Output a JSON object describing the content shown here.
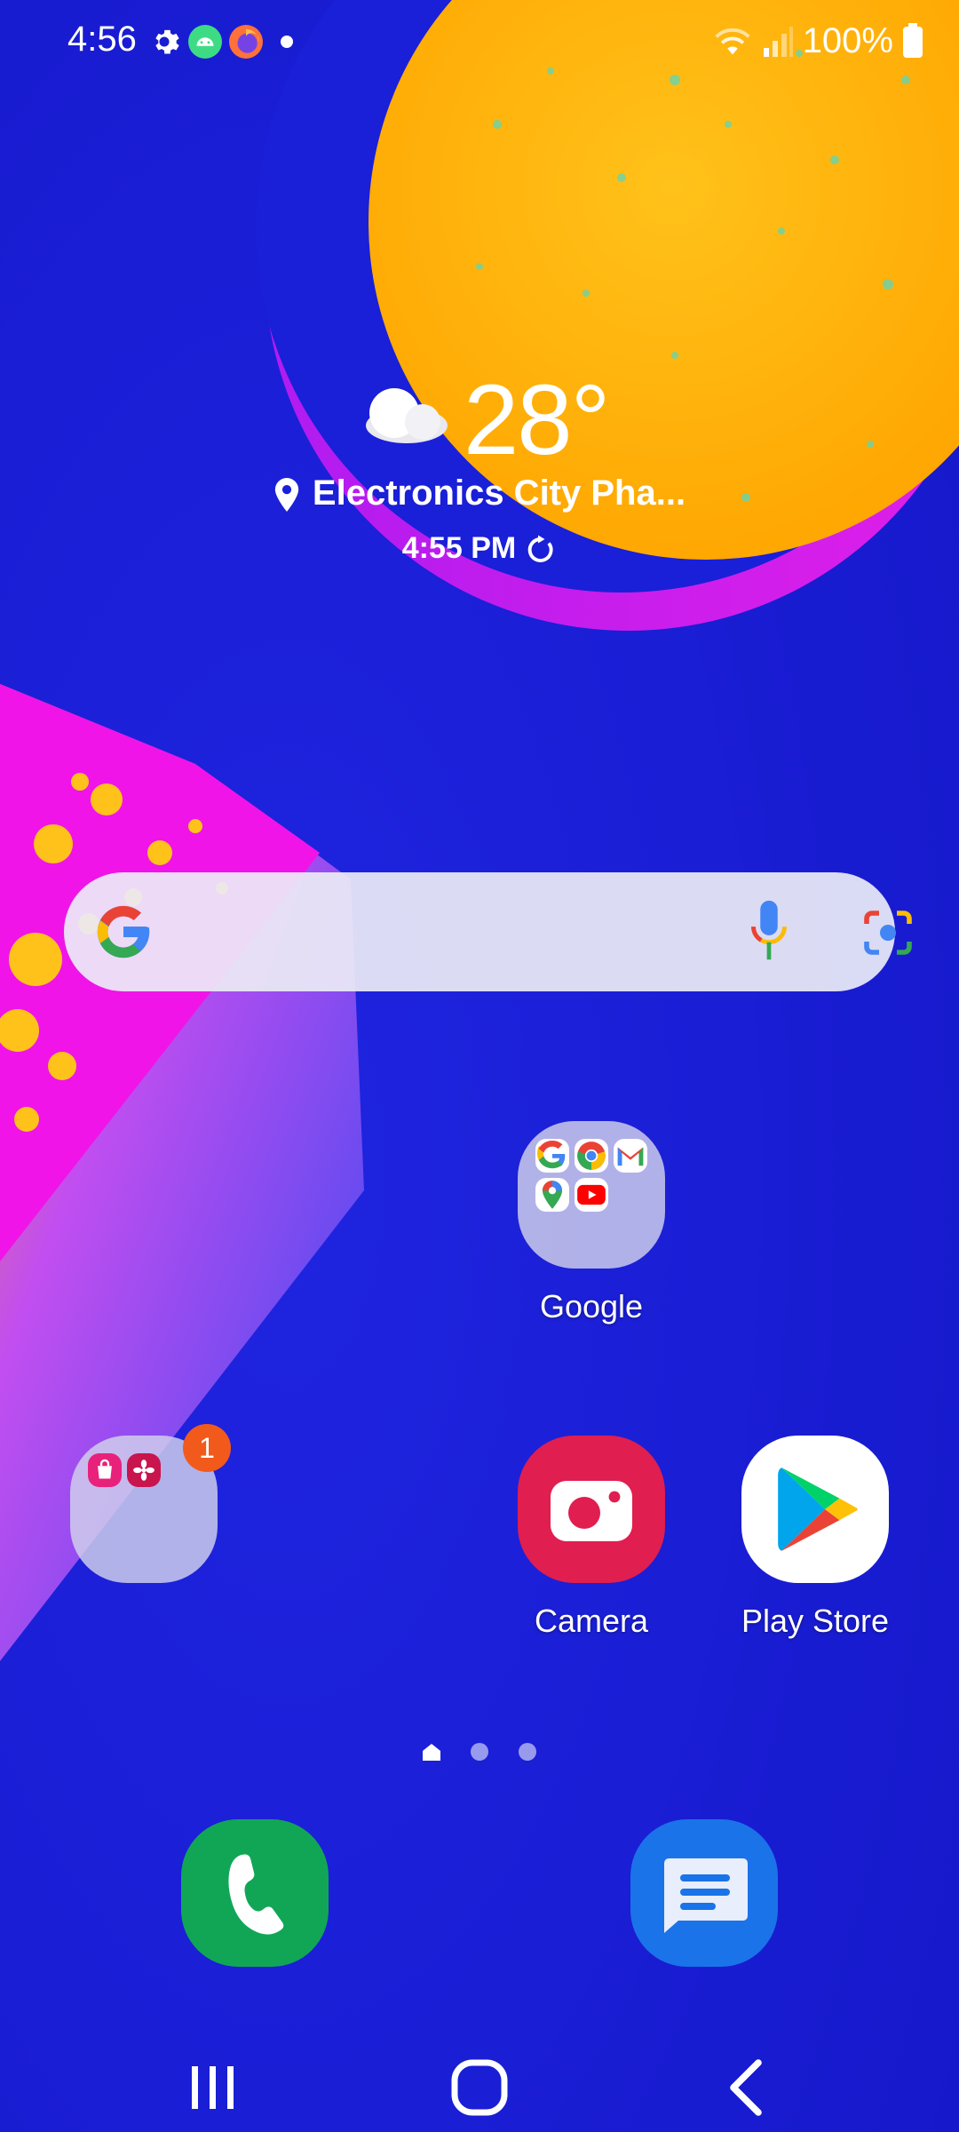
{
  "status_bar": {
    "time": "4:56",
    "battery": "100%",
    "icons": [
      "settings-icon",
      "android-icon",
      "firefox-icon",
      "notification-dot-icon",
      "wifi-icon",
      "signal-icon",
      "battery-icon"
    ]
  },
  "weather": {
    "temperature": "28°",
    "location": "Electronics City Pha...",
    "updated_time": "4:55 PM",
    "condition_icon": "cloud-icon"
  },
  "search": {
    "icons": [
      "google-g-icon",
      "microphone-icon",
      "lens-icon"
    ]
  },
  "apps": {
    "google_folder": {
      "label": "Google",
      "contents": [
        "google-icon",
        "chrome-icon",
        "gmail-icon",
        "maps-icon",
        "youtube-icon"
      ]
    },
    "samsung_folder": {
      "label": "",
      "badge": "1",
      "contents": [
        "galaxy-store-icon",
        "galaxy-flower-icon"
      ]
    },
    "camera": {
      "label": "Camera"
    },
    "play_store": {
      "label": "Play Store"
    }
  },
  "page_indicator": {
    "current": 1,
    "total": 3
  },
  "dock": [
    "phone-icon",
    "messages-icon"
  ],
  "nav_bar": [
    "recents-icon",
    "home-icon",
    "back-icon"
  ],
  "colors": {
    "background": "#1a1fd8",
    "sun": "#ffb300",
    "magenta": "#e81ce8",
    "camera_red": "#e01e4f",
    "phone_green": "#11a656",
    "messages_blue": "#1a73e8",
    "badge": "#f25a1c"
  }
}
